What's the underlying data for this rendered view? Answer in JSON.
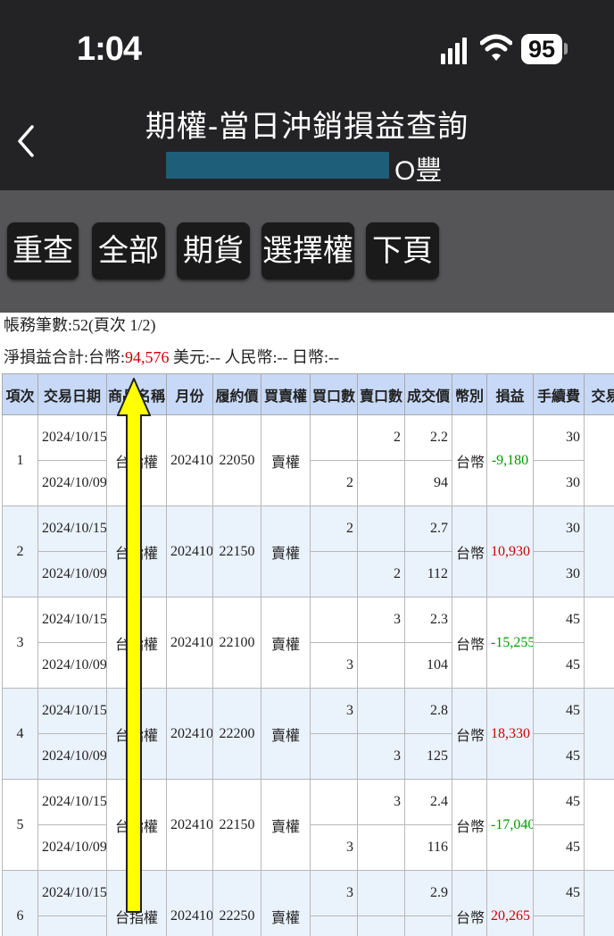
{
  "status_bar": {
    "time": "1:04",
    "battery": "95"
  },
  "nav": {
    "title": "期權-當日沖銷損益查詢",
    "account_suffix": "O豐"
  },
  "toolbar": {
    "buttons": [
      "重查",
      "全部",
      "期貨",
      "選擇權",
      "下頁"
    ]
  },
  "summary": {
    "record_line": "帳務筆數:52(頁次 1/2)",
    "net_label": "淨損益合計:台幣:",
    "net_twd": "94,576",
    "usd_label": "美元:--",
    "cny_label": "人民幣:--",
    "jpy_label": "日幣:--"
  },
  "table": {
    "headers": [
      "項次",
      "交易日期",
      "商品名稱",
      "月份",
      "履約價",
      "買賣權",
      "買口數",
      "賣口數",
      "成交價",
      "幣別",
      "損益",
      "手續費",
      "交易"
    ],
    "product_partial": "權",
    "rows": [
      {
        "no": "1",
        "date_top": "2024/10/15",
        "date_bottom": "2024/10/09",
        "product": "台指權",
        "month": "202410",
        "strike": "22050",
        "type": "賣權",
        "buy_top": "",
        "buy_bottom": "2",
        "sell_top": "2",
        "sell_bottom": "",
        "price_top": "2.2",
        "price_bottom": "94",
        "currency": "台幣",
        "pnl": "-9,180",
        "pnl_sign": "neg",
        "fee_top": "30",
        "fee_bottom": "30"
      },
      {
        "no": "2",
        "date_top": "2024/10/15",
        "date_bottom": "2024/10/09",
        "product": "台指權",
        "month": "202410",
        "strike": "22150",
        "type": "賣權",
        "buy_top": "2",
        "buy_bottom": "",
        "sell_top": "",
        "sell_bottom": "2",
        "price_top": "2.7",
        "price_bottom": "112",
        "currency": "台幣",
        "pnl": "10,930",
        "pnl_sign": "pos",
        "fee_top": "30",
        "fee_bottom": "30"
      },
      {
        "no": "3",
        "date_top": "2024/10/15",
        "date_bottom": "2024/10/09",
        "product": "台指權",
        "month": "202410",
        "strike": "22100",
        "type": "賣權",
        "buy_top": "",
        "buy_bottom": "3",
        "sell_top": "3",
        "sell_bottom": "",
        "price_top": "2.3",
        "price_bottom": "104",
        "currency": "台幣",
        "pnl": "-15,255",
        "pnl_sign": "neg",
        "fee_top": "45",
        "fee_bottom": "45"
      },
      {
        "no": "4",
        "date_top": "2024/10/15",
        "date_bottom": "2024/10/09",
        "product": "台指權",
        "month": "202410",
        "strike": "22200",
        "type": "賣權",
        "buy_top": "3",
        "buy_bottom": "",
        "sell_top": "",
        "sell_bottom": "3",
        "price_top": "2.8",
        "price_bottom": "125",
        "currency": "台幣",
        "pnl": "18,330",
        "pnl_sign": "pos",
        "fee_top": "45",
        "fee_bottom": "45"
      },
      {
        "no": "5",
        "date_top": "2024/10/15",
        "date_bottom": "2024/10/09",
        "product": "台指權",
        "month": "202410",
        "strike": "22150",
        "type": "賣權",
        "buy_top": "",
        "buy_bottom": "3",
        "sell_top": "3",
        "sell_bottom": "",
        "price_top": "2.4",
        "price_bottom": "116",
        "currency": "台幣",
        "pnl": "-17,040",
        "pnl_sign": "neg",
        "fee_top": "45",
        "fee_bottom": "45"
      },
      {
        "no": "6",
        "date_top": "2024/10/15",
        "date_bottom": "",
        "product": "台指權",
        "month": "202410",
        "strike": "22250",
        "type": "賣權",
        "buy_top": "3",
        "buy_bottom": "",
        "sell_top": "",
        "sell_bottom": "",
        "price_top": "2.9",
        "price_bottom": "",
        "currency": "台幣",
        "pnl": "20,265",
        "pnl_sign": "pos",
        "fee_top": "45",
        "fee_bottom": ""
      }
    ]
  },
  "colors": {
    "positive": "#d00000",
    "negative": "#009900",
    "header_bg": "#c7d9f7",
    "alt_row_bg": "#eaf2fc",
    "annotation_arrow": "#ffff00"
  }
}
